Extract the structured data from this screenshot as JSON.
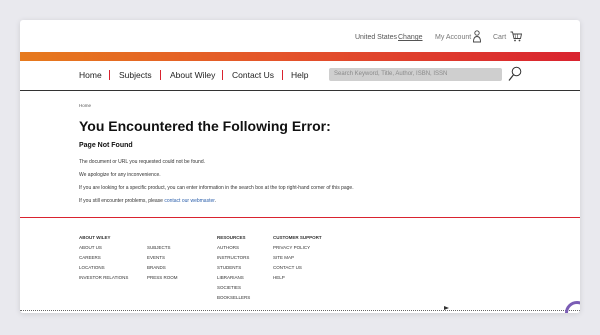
{
  "utility": {
    "country": "United States",
    "change_label": "Change",
    "account_label": "My Account",
    "cart_label": "Cart"
  },
  "nav": {
    "items": [
      "Home",
      "Subjects",
      "About Wiley",
      "Contact Us",
      "Help"
    ]
  },
  "search": {
    "placeholder": "Search Keyword, Title, Author, ISBN, ISSN"
  },
  "breadcrumb": "Home",
  "error": {
    "title": "You Encountered the Following Error:",
    "subtitle": "Page Not Found",
    "p1": "The document or URL you requested could not be found.",
    "p2": "We apologize for any inconvenience.",
    "p3": "If you are looking for a specific product, you can enter information in the search box at the top right-hand corner of this page.",
    "p4_prefix": "If you still encounter problems, please ",
    "p4_link": "contact our webmaster",
    "p4_suffix": "."
  },
  "footer": {
    "about_heading": "ABOUT WILEY",
    "about_links": [
      "ABOUT US",
      "CAREERS",
      "LOCATIONS",
      "INVESTOR RELATIONS"
    ],
    "about_links2": [
      "SUBJECTS",
      "EVENTS",
      "BRANDS",
      "PRESS ROOM"
    ],
    "resources_heading": "RESOURCES",
    "resources_links": [
      "AUTHORS",
      "INSTRUCTORS",
      "STUDENTS",
      "LIBRARIANS",
      "SOCIETIES",
      "BOOKSELLERS"
    ],
    "support_heading": "CUSTOMER SUPPORT",
    "support_links": [
      "PRIVACY POLICY",
      "SITE MAP",
      "CONTACT US",
      "HELP"
    ]
  },
  "colors": {
    "accent_red": "#d9232f",
    "accent_orange": "#e67a1d",
    "link_blue": "#2b5fab"
  }
}
